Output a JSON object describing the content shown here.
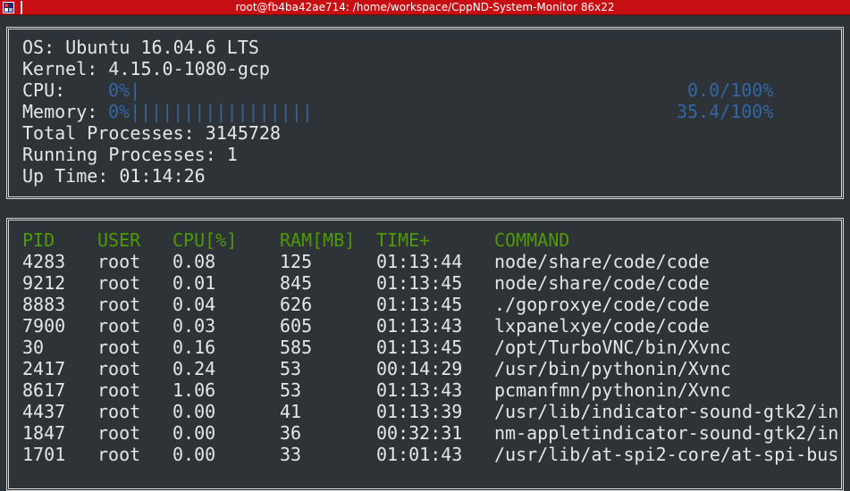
{
  "window": {
    "title": "root@fb4ba42ae714: /home/workspace/CppND-System-Monitor 86x22"
  },
  "system": {
    "os_label": "OS: ",
    "os_value": "Ubuntu 16.04.6 LTS",
    "kernel_label": "Kernel: ",
    "kernel_value": "4.15.0-1080-gcp",
    "cpu_label": "CPU: ",
    "cpu_bar": "0%|",
    "cpu_percent": "0.0/100%",
    "memory_label": "Memory: ",
    "memory_bar": "0%|||||||||||||||||",
    "memory_percent": "35.4/100%",
    "total_processes_label": "Total Processes: ",
    "total_processes_value": "3145728",
    "running_processes_label": "Running Processes: ",
    "running_processes_value": "1",
    "uptime_label": "Up Time: ",
    "uptime_value": "01:14:26"
  },
  "processes": {
    "headers": {
      "pid": "PID",
      "user": "USER",
      "cpu": "CPU[%]",
      "ram": "RAM[MB]",
      "time": "TIME+",
      "command": "COMMAND"
    },
    "rows": [
      {
        "pid": "4283",
        "user": "root",
        "cpu": "0.08",
        "ram": "125",
        "time": "01:13:44",
        "command": "node/share/code/code"
      },
      {
        "pid": "9212",
        "user": "root",
        "cpu": "0.01",
        "ram": "845",
        "time": "01:13:45",
        "command": "node/share/code/code"
      },
      {
        "pid": "8883",
        "user": "root",
        "cpu": "0.04",
        "ram": "626",
        "time": "01:13:45",
        "command": "./goproxye/code/code"
      },
      {
        "pid": "7900",
        "user": "root",
        "cpu": "0.03",
        "ram": "605",
        "time": "01:13:43",
        "command": "lxpanelxye/code/code"
      },
      {
        "pid": "30",
        "user": "root",
        "cpu": "0.16",
        "ram": "585",
        "time": "01:13:45",
        "command": "/opt/TurboVNC/bin/Xvnc"
      },
      {
        "pid": "2417",
        "user": "root",
        "cpu": "0.24",
        "ram": "53",
        "time": "00:14:29",
        "command": "/usr/bin/pythonin/Xvnc"
      },
      {
        "pid": "8617",
        "user": "root",
        "cpu": "1.06",
        "ram": "53",
        "time": "01:13:43",
        "command": "pcmanfmn/pythonin/Xvnc"
      },
      {
        "pid": "4437",
        "user": "root",
        "cpu": "0.00",
        "ram": "41",
        "time": "01:13:39",
        "command": "/usr/lib/indicator-sound-gtk2/in"
      },
      {
        "pid": "1847",
        "user": "root",
        "cpu": "0.00",
        "ram": "36",
        "time": "00:32:31",
        "command": "nm-appletindicator-sound-gtk2/in"
      },
      {
        "pid": "1701",
        "user": "root",
        "cpu": "0.00",
        "ram": "33",
        "time": "01:01:43",
        "command": "/usr/lib/at-spi2-core/at-spi-bus"
      }
    ]
  },
  "colors": {
    "titlebar": "#c70e12",
    "background": "#2d3336",
    "text": "#e6e6e6",
    "bar_blue": "#3465a4",
    "header_green": "#4e9a06"
  },
  "icons": {
    "window_menu": "terminal-app-icon"
  }
}
